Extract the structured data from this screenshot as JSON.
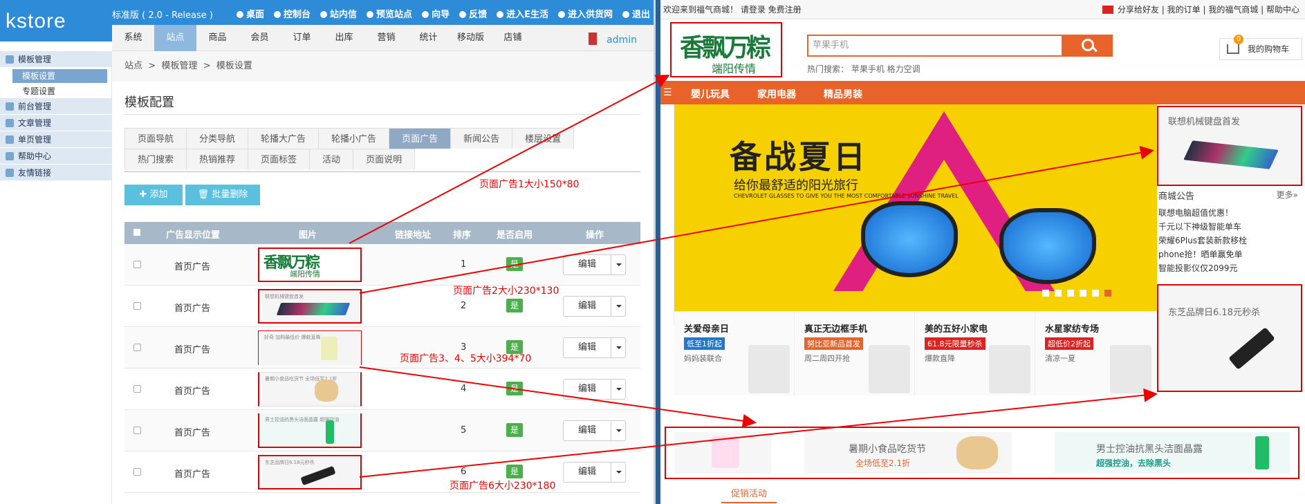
{
  "admin": {
    "logo": "kstore",
    "edition": "标准版 ( 2.0 - Release )",
    "top_links": [
      "桌面",
      "控制台",
      "站内信",
      "预览站点",
      "向导",
      "反馈",
      "进入E生活",
      "进入供货网",
      "退出"
    ],
    "nav_tabs": [
      "系统",
      "站点",
      "商品",
      "会员",
      "订单",
      "出库",
      "营销",
      "统计",
      "移动版",
      "店铺"
    ],
    "active_nav": "站点",
    "user": "admin",
    "sidebar": [
      {
        "label": "模板管理",
        "icon": "grid-icon",
        "items": [
          "模板设置",
          "专题设置"
        ]
      },
      {
        "label": "前台管理",
        "icon": "globe-icon",
        "items": []
      },
      {
        "label": "文章管理",
        "icon": "article-icon",
        "items": []
      },
      {
        "label": "单页管理",
        "icon": "page-icon",
        "items": []
      },
      {
        "label": "帮助中心",
        "icon": "help-icon",
        "items": []
      },
      {
        "label": "友情链接",
        "icon": "link-icon",
        "items": []
      }
    ],
    "breadcrumb": [
      "站点",
      "模板管理",
      "模板设置"
    ],
    "panel_title": "模板配置",
    "sub_tabs_row1": [
      "页面导航",
      "分类导航",
      "轮播大广告",
      "轮播小广告",
      "页面广告",
      "新闻公告",
      "楼层设置"
    ],
    "sub_tabs_row2": [
      "热门搜索",
      "热销推荐",
      "页面标签",
      "活动",
      "页面说明"
    ],
    "active_sub_tab": "页面广告",
    "add_button": "添加",
    "batch_delete_button": "批量删除",
    "table_headers": [
      "广告显示位置",
      "图片",
      "链接地址",
      "排序",
      "是否启用",
      "操作"
    ],
    "rows": [
      {
        "position": "首页广告",
        "sort": "1",
        "enabled": "是",
        "action": "编辑",
        "thumb_text": ""
      },
      {
        "position": "首页广告",
        "sort": "2",
        "enabled": "是",
        "action": "编辑",
        "thumb_text": "联想机械键盘首发"
      },
      {
        "position": "首页广告",
        "sort": "3",
        "enabled": "是",
        "action": "编辑",
        "thumb_text": "好奇 加购最低价 爆款直降"
      },
      {
        "position": "首页广告",
        "sort": "4",
        "enabled": "是",
        "action": "编辑",
        "thumb_text": "暑期小食品吃货节 全场低至2.1折"
      },
      {
        "position": "首页广告",
        "sort": "5",
        "enabled": "是",
        "action": "编辑",
        "thumb_text": "男士控油抗黑头洁面晶露 超强控油"
      },
      {
        "position": "首页广告",
        "sort": "6",
        "enabled": "是",
        "action": "编辑",
        "thumb_text": "东芝品牌日6.18元秒杀"
      }
    ],
    "brand_thumb": {
      "line1": "香飘万粽",
      "line2": "端阳传情"
    }
  },
  "store": {
    "top_left": "欢迎来到福气商城！  请登录  免费注册",
    "top_right": "分享给好友 | 我的订单 | 我的福气商城 | 帮助中心",
    "brand": {
      "line1": "香飘万粽",
      "line2": "端阳传情"
    },
    "search_placeholder": "苹果手机",
    "hot_search": "热门搜索：  苹果手机    格力空调",
    "cart_label": "我的购物车",
    "cart_count": "0",
    "menu": [
      "婴儿玩具",
      "家用电器",
      "精品男装"
    ],
    "banner": {
      "title": "备战夏日",
      "subtitle": "给你最舒适的阳光旅行",
      "english": "CHEVROLET GLASSES TO GIVE YOU THE MOST COMFORTABLE SUNSHINE TRAVEL"
    },
    "side_ad_1": "联想机械键盘首发",
    "notice_title": "商城公告",
    "notice_more": "更多»",
    "notices": [
      "联想电脑超值优惠！",
      "千元以下神级智能单车",
      "荣耀6Plus套装新款移栓",
      "phone抢！晒单赢免单",
      "智能投影仪仅2099元"
    ],
    "side_ad_2": "东芝品牌日6.18元秒杀",
    "promos": [
      {
        "title": "关爱母亲日",
        "tag": "低至1折起",
        "sub": "妈妈装联合"
      },
      {
        "title": "真正无边框手机",
        "tag": "努比亚新品首发",
        "sub": "周二周四开抢"
      },
      {
        "title": "美的五好小家电",
        "tag": "61.8元限量秒杀",
        "sub": "爆款直降"
      },
      {
        "title": "水星家纺专场",
        "tag": "超低价2折起",
        "sub": "清凉一夏"
      }
    ],
    "strip": [
      {
        "title": "",
        "sub": ""
      },
      {
        "title": "暑期小食品吃货节",
        "sub": "全场低至2.1折"
      },
      {
        "title": "男士控油抗黑头洁面晶露",
        "sub": "超强控油，去除黑头"
      }
    ],
    "promo_activity": "促销活动"
  },
  "annotations": {
    "ad1": "页面广告1大小150*80",
    "ad2": "页面广告2大小230*130",
    "ad345": "页面广告3、4、5大小394*70",
    "ad6": "页面广告6大小230*180"
  },
  "colors": {
    "admin_blue": "#2e8bd8",
    "store_orange": "#e8632a",
    "annotation_red": "#e00000",
    "enabled_green": "#4cae4c"
  }
}
